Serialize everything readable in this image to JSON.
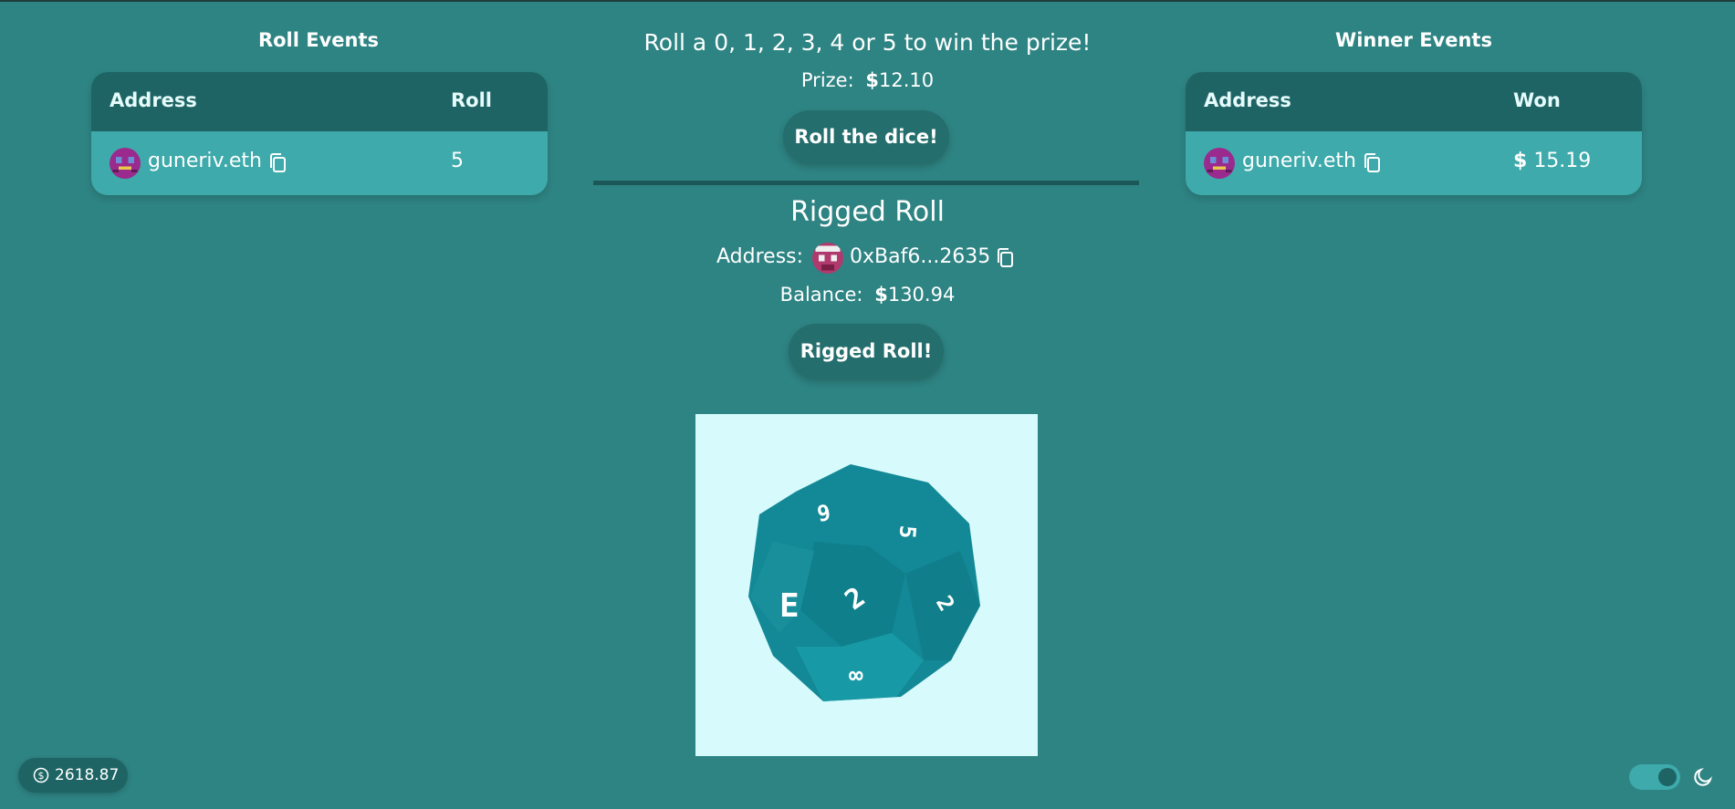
{
  "roll_events": {
    "title": "Roll Events",
    "columns": [
      "Address",
      "Roll"
    ],
    "rows": [
      {
        "address": "guneriv.eth",
        "roll": "5"
      }
    ]
  },
  "winner_events": {
    "title": "Winner Events",
    "columns": [
      "Address",
      "Won"
    ],
    "rows": [
      {
        "address": "guneriv.eth",
        "won": "15.19"
      }
    ]
  },
  "game": {
    "headline": "Roll a 0, 1, 2, 3, 4 or 5 to win the prize!",
    "prize_label": "Prize:",
    "prize_value": "12.10",
    "roll_button": "Roll the dice!"
  },
  "rigged": {
    "title": "Rigged Roll",
    "address_label": "Address:",
    "address_value": "0xBaf6...2635",
    "balance_label": "Balance:",
    "balance_value": "130.94",
    "button": "Rigged Roll!"
  },
  "dice": {
    "faces": [
      "9",
      "5",
      "E",
      "2",
      "2",
      "∞"
    ]
  },
  "footer": {
    "wallet_balance": "2618.87",
    "theme_toggle_on": true
  },
  "icons": [
    "avatar-icon",
    "copy-icon",
    "dollar-icon",
    "moon-icon"
  ],
  "colors": {
    "background": "#2e8483",
    "card": "#3eaaab",
    "card_header": "#1e6464",
    "button": "#246e6d",
    "dice_background": "#d7fbfd"
  }
}
